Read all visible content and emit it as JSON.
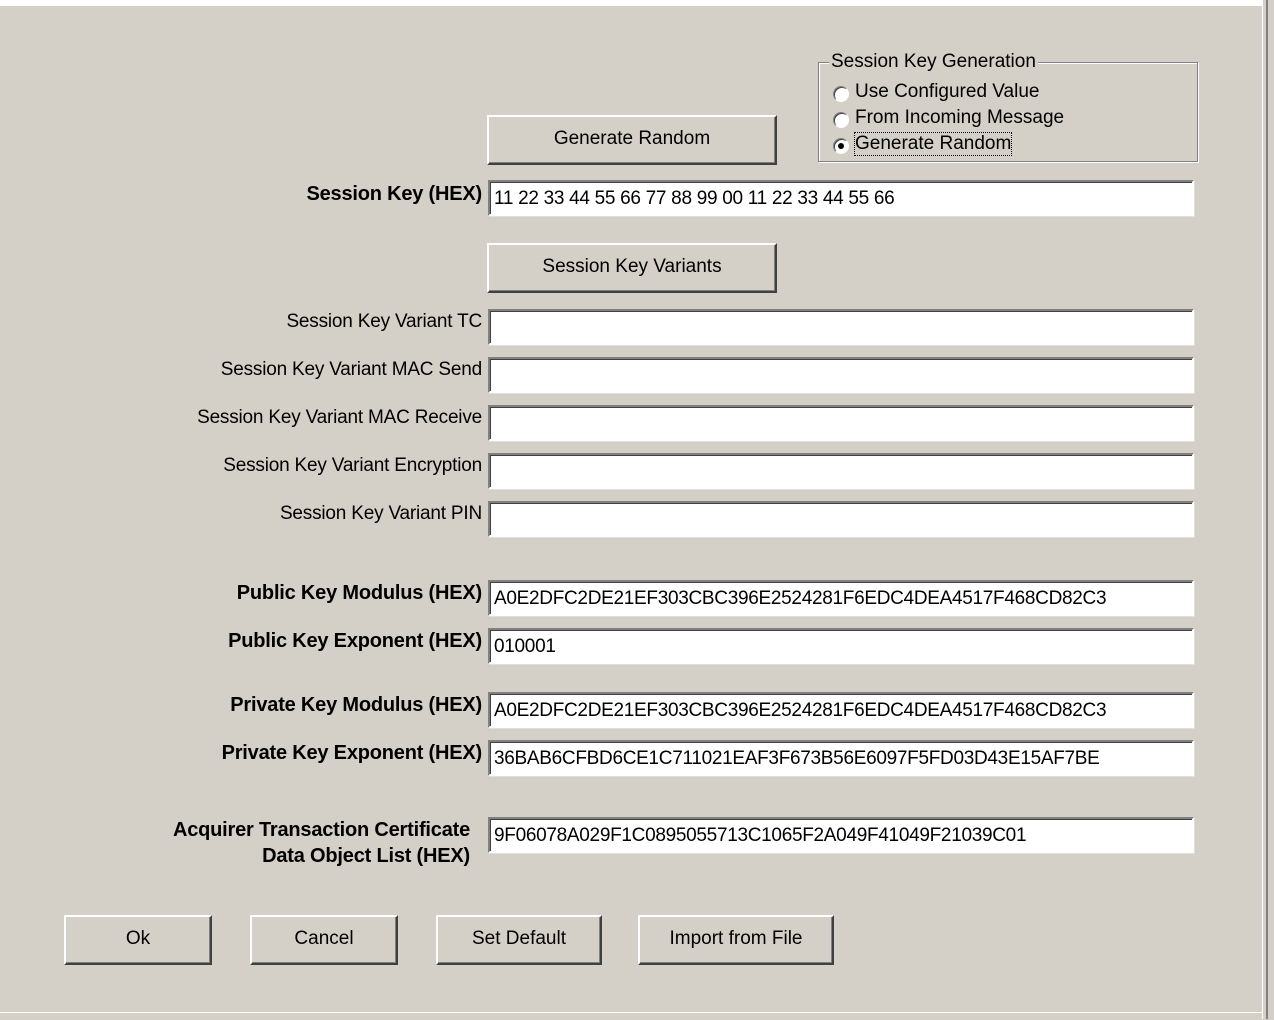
{
  "generation": {
    "title": "Session Key Generation",
    "options": [
      "Use Configured Value",
      "From Incoming Message",
      "Generate Random"
    ],
    "selected": "Generate Random"
  },
  "buttons": {
    "generate_random": "Generate Random",
    "session_key_variants": "Session Key Variants",
    "ok": "Ok",
    "cancel": "Cancel",
    "set_default": "Set Default",
    "import_from_file": "Import from File"
  },
  "fields": {
    "session_key": {
      "label": "Session Key (HEX)",
      "value": "11 22 33 44 55 66 77 88 99 00 11 22 33 44 55 66"
    },
    "variant_tc": {
      "label": "Session Key Variant TC",
      "value": ""
    },
    "variant_mac_send": {
      "label": "Session Key Variant MAC Send",
      "value": ""
    },
    "variant_mac_receive": {
      "label": "Session Key Variant MAC Receive",
      "value": ""
    },
    "variant_encryption": {
      "label": "Session Key Variant Encryption",
      "value": ""
    },
    "variant_pin": {
      "label": "Session Key Variant PIN",
      "value": ""
    },
    "public_modulus": {
      "label": "Public Key Modulus (HEX)",
      "value": "A0E2DFC2DE21EF303CBC396E2524281F6EDC4DEA4517F468CD82C3"
    },
    "public_exponent": {
      "label": "Public Key Exponent (HEX)",
      "value": "010001"
    },
    "private_modulus": {
      "label": "Private Key Modulus (HEX)",
      "value": "A0E2DFC2DE21EF303CBC396E2524281F6EDC4DEA4517F468CD82C3"
    },
    "private_exponent": {
      "label": "Private Key Exponent (HEX)",
      "value": "36BAB6CFBD6CE1C711021EAF3F673B56E6097F5FD03D43E15AF7BE"
    },
    "acquirer_tc_dol": {
      "label_line1": "Acquirer Transaction Certificate",
      "label_line2": "Data Object List (HEX)",
      "value": "9F06078A029F1C0895055713C1065F2A049F41049F21039C01"
    }
  }
}
